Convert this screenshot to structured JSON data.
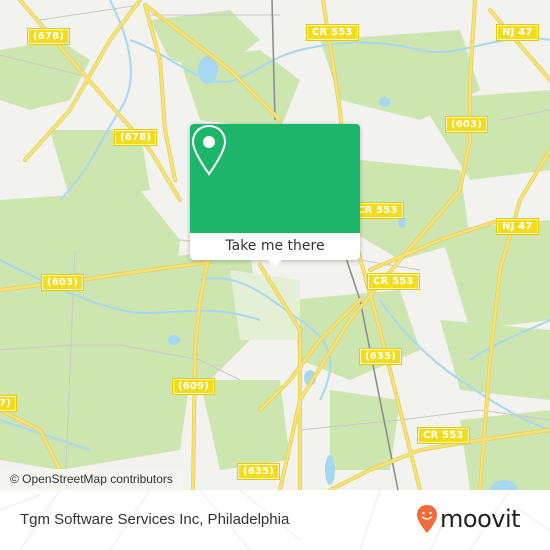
{
  "map": {
    "colors": {
      "land": "#f2f2ee",
      "forest": "#cde6b0",
      "water": "#a8d8f0",
      "road": "#f4e06a",
      "road_edge": "#e6cf52",
      "rail": "#8a8a8a",
      "minor_road": "#c8c8c8"
    },
    "road_labels": [
      {
        "id": "678-a",
        "text": "(678)"
      },
      {
        "id": "678-b",
        "text": "(678)"
      },
      {
        "id": "cr553-top",
        "text": "CR 553"
      },
      {
        "id": "nj47-top",
        "text": "NJ 47"
      },
      {
        "id": "603-right",
        "text": "(603)"
      },
      {
        "id": "cr553-mid",
        "text": "CR 553"
      },
      {
        "id": "nj47-right",
        "text": "NJ 47"
      },
      {
        "id": "603-left",
        "text": "(603)"
      },
      {
        "id": "cr553-lower",
        "text": "CR 553"
      },
      {
        "id": "635-mid",
        "text": "(635)"
      },
      {
        "id": "609",
        "text": "(609)"
      },
      {
        "id": "edge-left",
        "text": "7)"
      },
      {
        "id": "cr553-bottom",
        "text": "CR 553"
      },
      {
        "id": "635-bottom",
        "text": "(635)"
      }
    ],
    "attribution": "© OpenStreetMap contributors"
  },
  "popup": {
    "action_label": "Take me there",
    "icon": "map-pin-icon",
    "color": "#1db56a"
  },
  "footer": {
    "place_name": "Tgm Software Services Inc, Philadelphia",
    "brand": "moovit",
    "brand_color": "#f26b3a"
  }
}
